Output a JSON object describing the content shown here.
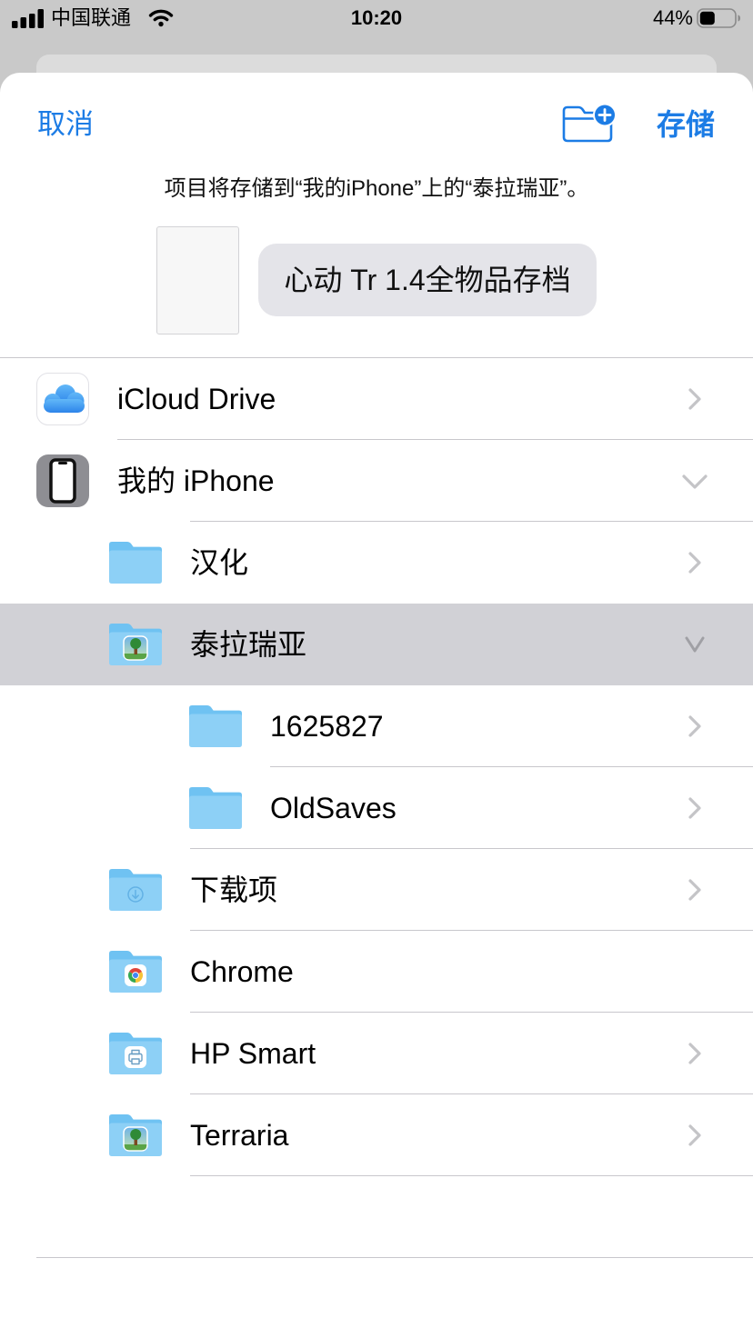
{
  "status_bar": {
    "carrier": "中国联通",
    "time": "10:20",
    "battery_text": "44%",
    "battery_level": 0.44
  },
  "sheet": {
    "cancel_label": "取消",
    "new_folder_icon": "folder-badge-plus-icon",
    "save_label": "存储",
    "destination_message": "项目将存储到“我的iPhone”上的“泰拉瑞亚”。",
    "file_name": "心动 Tr 1.4全物品存档"
  },
  "locations": [
    {
      "label": "iCloud Drive",
      "icon": "icloud-icon"
    },
    {
      "label": "我的 iPhone",
      "icon": "iphone-icon",
      "expanded": true
    },
    {
      "label": "汉化",
      "icon": "folder-icon"
    },
    {
      "label": "泰拉瑞亚",
      "icon": "terraria-folder-icon",
      "expanded": true,
      "selected": true
    },
    {
      "label": "1625827",
      "icon": "folder-icon"
    },
    {
      "label": "OldSaves",
      "icon": "folder-icon"
    },
    {
      "label": "下载项",
      "icon": "downloads-folder-icon"
    },
    {
      "label": "Chrome",
      "icon": "chrome-folder-icon"
    },
    {
      "label": "HP Smart",
      "icon": "hp-smart-folder-icon"
    },
    {
      "label": "Terraria",
      "icon": "terraria-folder-icon"
    }
  ],
  "colors": {
    "accent": "#1c7ce5",
    "selected_row": "#d1d1d6",
    "folder": "#8dd0f6"
  }
}
